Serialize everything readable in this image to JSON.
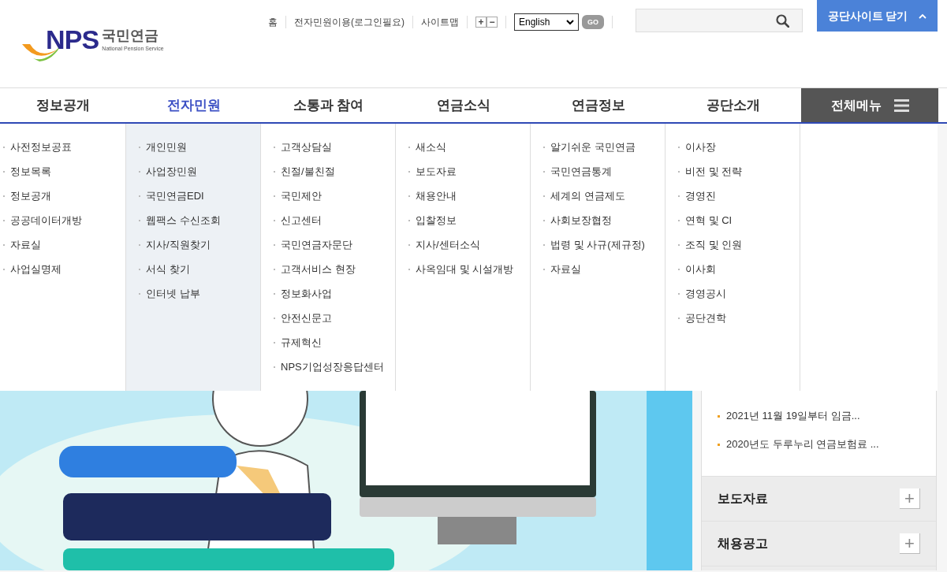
{
  "logo": {
    "mark": "NPS",
    "name": "국민연금",
    "subtitle": "National Pension Service"
  },
  "top_links": [
    "홈",
    "전자민원이용(로그인필요)",
    "사이트맵"
  ],
  "font_size_buttons": [
    "+",
    "−"
  ],
  "language_select": {
    "value": "English"
  },
  "go_button": "GO",
  "close_site_button": "공단사이트 닫기",
  "nav": [
    {
      "label": "정보공개",
      "selected": false,
      "items": [
        "사전정보공표",
        "정보목록",
        "정보공개",
        "공공데이터개방",
        "자료실",
        "사업실명제"
      ]
    },
    {
      "label": "전자민원",
      "selected": true,
      "items": [
        "개인민원",
        "사업장민원",
        "국민연금EDI",
        "웹팩스 수신조회",
        "지사/직원찾기",
        "서식 찾기",
        "인터넷 납부"
      ]
    },
    {
      "label": "소통과 참여",
      "selected": false,
      "items": [
        "고객상담실",
        "친절/불친절",
        "국민제안",
        "신고센터",
        "국민연금자문단",
        "고객서비스 현장",
        "정보화사업",
        "안전신문고",
        "규제혁신",
        "NPS기업성장응답센터"
      ]
    },
    {
      "label": "연금소식",
      "selected": false,
      "items": [
        "새소식",
        "보도자료",
        "채용안내",
        "입찰정보",
        "지사/센터소식",
        "사옥임대 및 시설개방"
      ]
    },
    {
      "label": "연금정보",
      "selected": false,
      "items": [
        "알기쉬운 국민연금",
        "국민연금통계",
        "세계의 연금제도",
        "사회보장협정",
        "법령 및 사규(제규정)",
        "자료실"
      ]
    },
    {
      "label": "공단소개",
      "selected": false,
      "items": [
        "이사장",
        "비전 및 전략",
        "경영진",
        "연혁 및 CI",
        "조직 및 인원",
        "이사회",
        "경영공시",
        "공단견학"
      ]
    }
  ],
  "all_menu_button": "전체메뉴",
  "banner": {
    "kind": "picture"
  },
  "news_items": [
    "2021년 11월 19일부터 임금...",
    "2020년도 두루누리 연금보험료 ..."
  ],
  "sections": [
    {
      "title": "보도자료",
      "button": "+"
    },
    {
      "title": "채용공고",
      "button": "+"
    }
  ]
}
